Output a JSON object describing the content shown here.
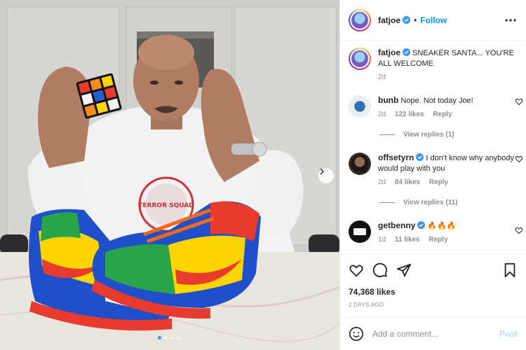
{
  "post": {
    "username": "fatjoe",
    "follow_label": "Follow",
    "bullet": "•",
    "caption": "SNEAKER SANTA... YOU'RE ALL WELCOME",
    "caption_time": "2d",
    "likes": "74,368 likes",
    "date": "2 DAYS AGO"
  },
  "photo": {
    "logo_text": "TERROR SQUAD"
  },
  "comments": [
    {
      "username": "bunb",
      "text": "Nope. Not today Joe!",
      "time": "2d",
      "likes": "122 likes",
      "reply": "Reply",
      "view_replies": "View replies (1)"
    },
    {
      "username": "offsetyrn",
      "text": "I don't know why anybody would play with you",
      "time": "2d",
      "likes": "84 likes",
      "reply": "Reply",
      "view_replies": "View replies (11)"
    },
    {
      "username": "getbenny",
      "text": "🔥🔥🔥",
      "time": "1d",
      "likes": "11 likes",
      "reply": "Reply"
    }
  ],
  "add_comment": {
    "placeholder": "Add a comment...",
    "post_label": "Post"
  },
  "colors": {
    "accent": "#0095f6",
    "verified": "#3897f0",
    "post_disabled": "#b2dffc"
  },
  "icons": [
    "heart-icon",
    "comment-icon",
    "share-icon",
    "bookmark-icon",
    "emoji-icon",
    "more-icon",
    "chevron-right-icon",
    "verified-icon"
  ]
}
